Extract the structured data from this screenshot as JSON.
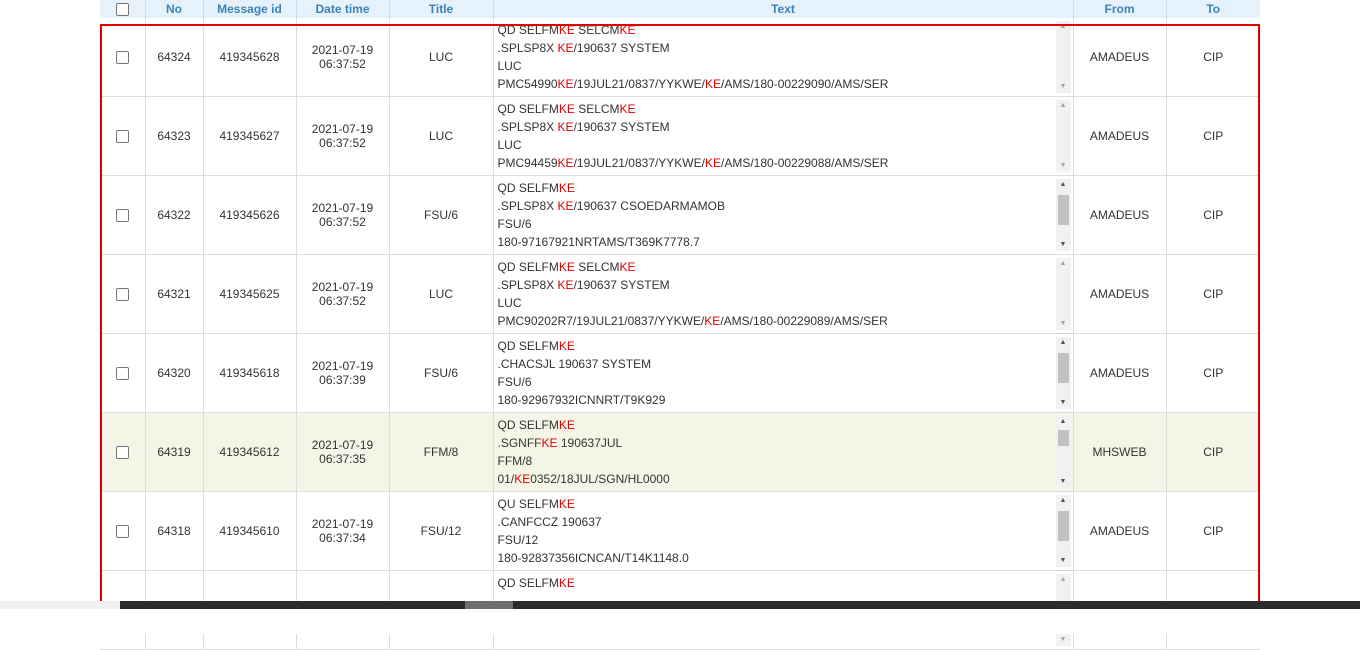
{
  "columns": {
    "no": "No",
    "message_id": "Message id",
    "date_time": "Date time",
    "title": "Title",
    "text": "Text",
    "from": "From",
    "to": "To"
  },
  "rows": [
    {
      "no": "64324",
      "message_id": "419345628",
      "date": "2021-07-19",
      "time": "06:37:52",
      "title": "LUC",
      "text_lines": [
        "QD SELFMKE SELCMKE",
        ".SPLSP8X KE/190637 SYSTEM",
        "LUC",
        "PMC54990KE/19JUL21/0837/YYKWE/KE/AMS/180-00229090/AMS/SER"
      ],
      "from": "AMADEUS",
      "to": "CIP"
    },
    {
      "no": "64323",
      "message_id": "419345627",
      "date": "2021-07-19",
      "time": "06:37:52",
      "title": "LUC",
      "text_lines": [
        "QD SELFMKE SELCMKE",
        ".SPLSP8X KE/190637 SYSTEM",
        "LUC",
        "PMC94459KE/19JUL21/0837/YYKWE/KE/AMS/180-00229088/AMS/SER"
      ],
      "from": "AMADEUS",
      "to": "CIP"
    },
    {
      "no": "64322",
      "message_id": "419345626",
      "date": "2021-07-19",
      "time": "06:37:52",
      "title": "FSU/6",
      "text_lines": [
        "QD SELFMKE",
        ".SPLSP8X KE/190637 CSOEDARMAMOB",
        "FSU/6",
        "180-97167921NRTAMS/T369K7778.7"
      ],
      "from": "AMADEUS",
      "to": "CIP"
    },
    {
      "no": "64321",
      "message_id": "419345625",
      "date": "2021-07-19",
      "time": "06:37:52",
      "title": "LUC",
      "text_lines": [
        "QD SELFMKE SELCMKE",
        ".SPLSP8X KE/190637 SYSTEM",
        "LUC",
        "PMC90202R7/19JUL21/0837/YYKWE/KE/AMS/180-00229089/AMS/SER"
      ],
      "from": "AMADEUS",
      "to": "CIP"
    },
    {
      "no": "64320",
      "message_id": "419345618",
      "date": "2021-07-19",
      "time": "06:37:39",
      "title": "FSU/6",
      "text_lines": [
        "QD SELFMKE",
        ".CHACSJL 190637 SYSTEM",
        "FSU/6",
        "180-92967932ICNNRT/T9K929"
      ],
      "from": "AMADEUS",
      "to": "CIP"
    },
    {
      "no": "64319",
      "message_id": "419345612",
      "date": "2021-07-19",
      "time": "06:37:35",
      "title": "FFM/8",
      "text_lines": [
        "QD SELFMKE",
        ".SGNFFKE 190637JUL",
        "FFM/8",
        "01/KE0352/18JUL/SGN/HL0000"
      ],
      "from": "MHSWEB",
      "to": "CIP"
    },
    {
      "no": "64318",
      "message_id": "419345610",
      "date": "2021-07-19",
      "time": "06:37:34",
      "title": "FSU/12",
      "text_lines": [
        "QU SELFMKE",
        ".CANFCCZ 190637",
        "FSU/12",
        "180-92837356ICNCAN/T14K1148.0"
      ],
      "from": "AMADEUS",
      "to": "CIP"
    },
    {
      "no": "",
      "message_id": "",
      "date": "",
      "time": "",
      "title": "",
      "text_lines": [
        "QD SELFMKE",
        "",
        "",
        ""
      ],
      "from": "",
      "to": ""
    }
  ],
  "highlight_term": "KE",
  "highlight_color": "#e00000",
  "selected_row_index": 5,
  "header_color": "#3b82b7",
  "header_bg": "#e6f2fb",
  "scrollbars": {
    "icons": [
      "scroll-up-arrow-icon",
      "scroll-down-arrow-icon"
    ]
  }
}
